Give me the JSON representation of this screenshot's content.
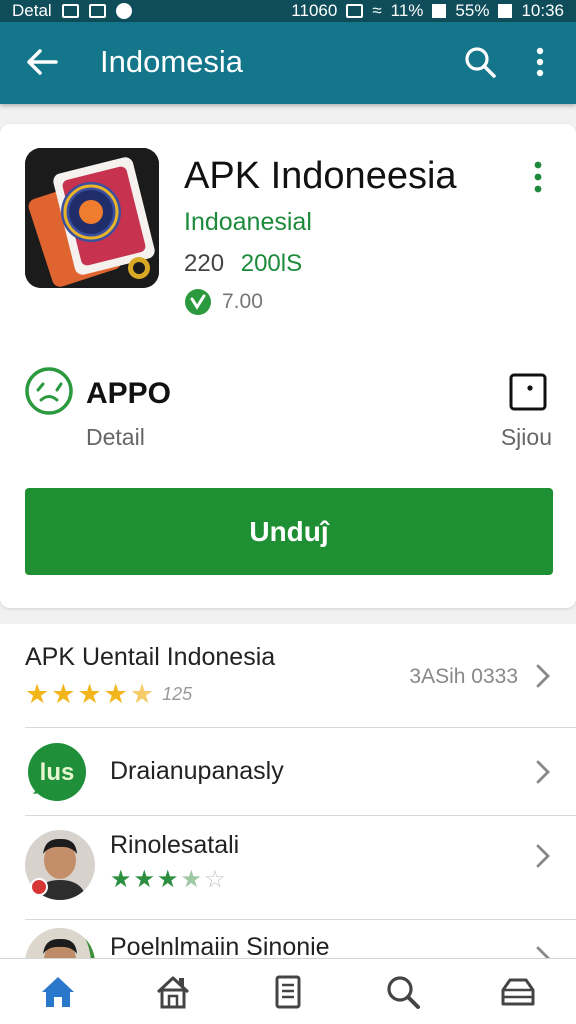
{
  "status_bar": {
    "carrier": "Detal",
    "icons_left": [
      "notification-icon",
      "image-icon",
      "app-icon"
    ],
    "network": "11060",
    "battery_small": "11%",
    "battery": "55%",
    "time": "10:36"
  },
  "app_bar": {
    "title": "Indomesia",
    "back_icon": "arrow-left-icon",
    "search_icon": "search-icon",
    "more_icon": "more-vertical-icon",
    "background": "#13768b"
  },
  "app": {
    "name": "APK Indoneesia",
    "developer": "Indoanesial",
    "meta_number": "220",
    "meta_tag": "200lS",
    "rating_value": "7.00"
  },
  "info": {
    "title": "APPO",
    "subtitle": "Detail",
    "share_label": "Sjiou"
  },
  "install": {
    "label": "Unduĵ",
    "color": "#1e8f33"
  },
  "list": {
    "items": [
      {
        "title": "APK Uentail Indonesia",
        "right_text": "3ASih 0333",
        "stars": 4.5,
        "star_count": "125"
      },
      {
        "title": "Draianupanasly",
        "icon_text": "lus"
      },
      {
        "title": "Rinolesatali",
        "stars": 3.5
      },
      {
        "title": "Poelnlmaiin Sinonie"
      }
    ]
  },
  "bottom_nav": {
    "items": [
      "home-icon",
      "store-icon",
      "document-icon",
      "search-icon",
      "inbox-icon"
    ],
    "active_color": "#2a78cc"
  }
}
